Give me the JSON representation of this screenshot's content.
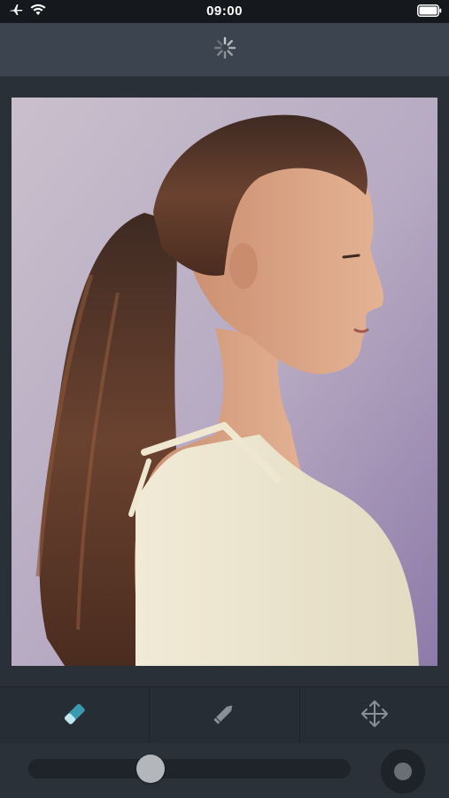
{
  "status_bar": {
    "time": "09:00",
    "icons": [
      "airplane-icon",
      "wifi-icon",
      "battery-icon"
    ]
  },
  "top_bar": {
    "activity_icon": "loading-spinner-icon"
  },
  "photo": {
    "description_icon": "portrait-photo"
  },
  "tools": [
    {
      "name": "eraser-tool",
      "icon": "eraser-icon",
      "active": true,
      "color": "#3a9bb0"
    },
    {
      "name": "pencil-tool",
      "icon": "pencil-icon",
      "active": false,
      "color": "#8a9099"
    },
    {
      "name": "move-tool",
      "icon": "move-icon",
      "active": false,
      "color": "#8a9099"
    }
  ],
  "brush": {
    "size_fraction": 0.38
  },
  "colors": {
    "accent": "#3a9bb0",
    "inactive_icon": "#8a9099",
    "toolbar_bg": "#3c454f",
    "canvas_bg": "#2a3038"
  }
}
